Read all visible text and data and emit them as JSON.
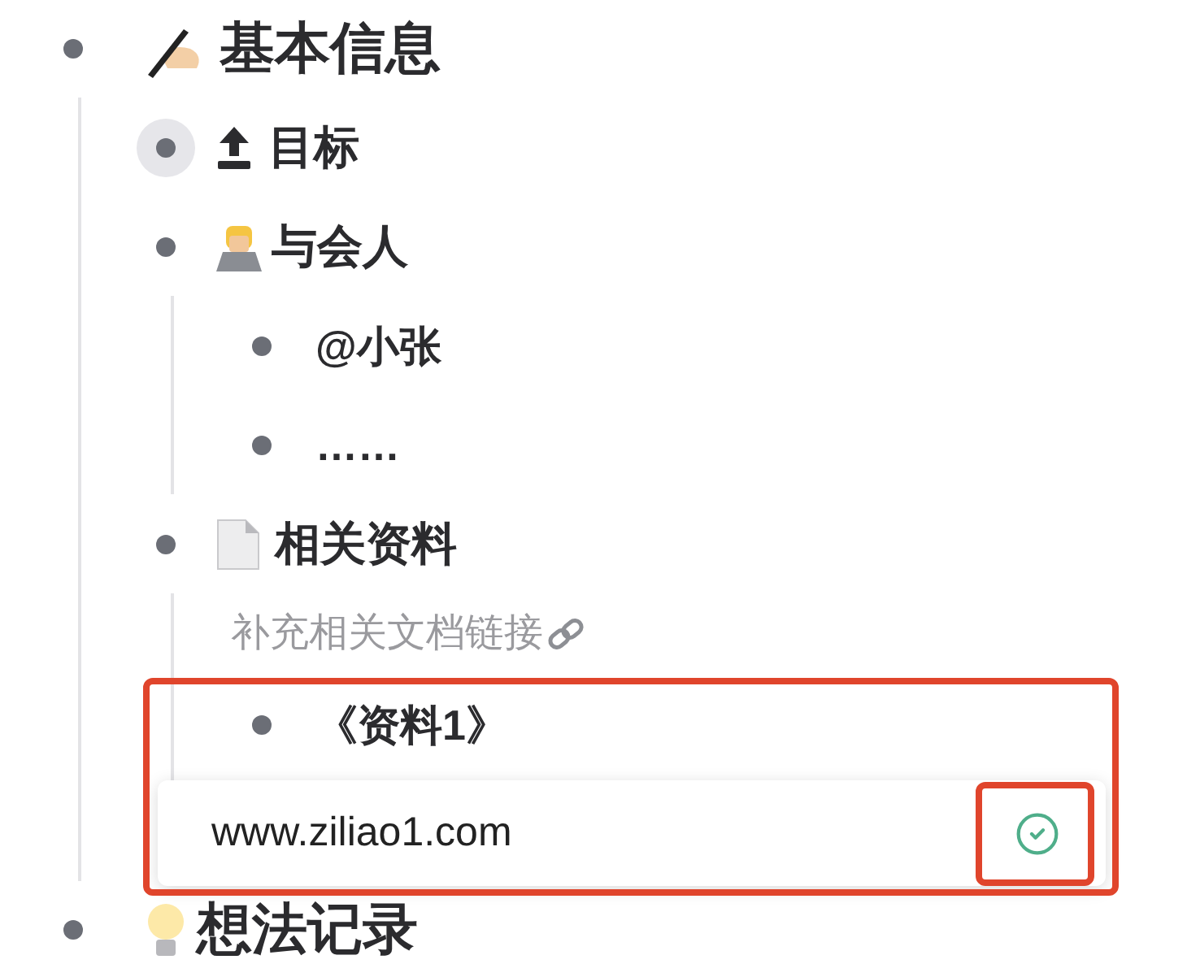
{
  "outline": [
    {
      "text": "基本信息",
      "selected": false,
      "children": [
        {
          "text": "目标",
          "selected": true
        },
        {
          "text": "与会人",
          "selected": false,
          "children": [
            {
              "text": "@小张",
              "selected": false
            },
            {
              "text": "……",
              "selected": false
            }
          ]
        },
        {
          "text": "相关资料",
          "selected": false,
          "note": "补充相关文档链接",
          "children": [
            {
              "text": "《资料1》",
              "selected": false
            }
          ]
        }
      ]
    },
    {
      "text": "想法记录",
      "selected": false
    }
  ],
  "link_popup": {
    "url": "www.ziliao1.com"
  }
}
